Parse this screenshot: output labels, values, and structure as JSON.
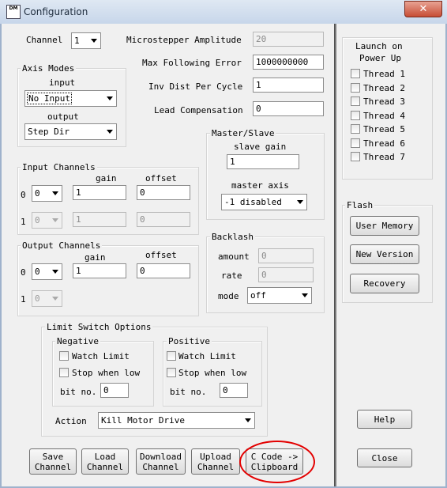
{
  "window": {
    "title": "Configuration",
    "icon_label": "DM",
    "close_glyph": "✕"
  },
  "channel": {
    "label": "Channel",
    "value": "1"
  },
  "fields": {
    "microstepper_label": "Microstepper Amplitude",
    "microstepper_value": "20",
    "max_following_label": "Max Following Error",
    "max_following_value": "1000000000",
    "inv_dist_label": "Inv Dist Per Cycle",
    "inv_dist_value": "1",
    "lead_comp_label": "Lead Compensation",
    "lead_comp_value": "0"
  },
  "axis_modes": {
    "title": "Axis Modes",
    "input_label": "input",
    "input_value": "No Input",
    "output_label": "output",
    "output_value": "Step Dir"
  },
  "input_channels": {
    "title": "Input Channels",
    "gain_header": "gain",
    "offset_header": "offset",
    "rows": [
      {
        "index": "0",
        "channel": "0",
        "gain": "1",
        "offset": "0"
      },
      {
        "index": "1",
        "channel": "0",
        "gain": "1",
        "offset": "0"
      }
    ]
  },
  "output_channels": {
    "title": "Output Channels",
    "gain_header": "gain",
    "offset_header": "offset",
    "rows": [
      {
        "index": "0",
        "channel": "0",
        "gain": "1",
        "offset": "0"
      },
      {
        "index": "1",
        "channel": "0"
      }
    ]
  },
  "master_slave": {
    "title": "Master/Slave",
    "slave_gain_label": "slave gain",
    "slave_gain_value": "1",
    "master_axis_label": "master axis",
    "master_axis_value": "-1 disabled"
  },
  "backlash": {
    "title": "Backlash",
    "amount_label": "amount",
    "amount_value": "0",
    "rate_label": "rate",
    "rate_value": "0",
    "mode_label": "mode",
    "mode_value": "off"
  },
  "limit_switch": {
    "title": "Limit Switch Options",
    "negative": {
      "title": "Negative",
      "watch_limit": "Watch Limit",
      "stop_when_low": "Stop when low",
      "bit_label": "bit no.",
      "bit_value": "0"
    },
    "positive": {
      "title": "Positive",
      "watch_limit": "Watch Limit",
      "stop_when_low": "Stop when low",
      "bit_label": "bit no.",
      "bit_value": "0"
    },
    "action_label": "Action",
    "action_value": "Kill Motor Drive"
  },
  "launch": {
    "title_line1": "Launch on",
    "title_line2": "Power Up",
    "threads": [
      "Thread 1",
      "Thread 2",
      "Thread 3",
      "Thread 4",
      "Thread 5",
      "Thread 6",
      "Thread 7"
    ]
  },
  "flash": {
    "title": "Flash",
    "user_memory": "User Memory",
    "new_version": "New Version",
    "recovery": "Recovery"
  },
  "buttons": {
    "save_l1": "Save",
    "save_l2": "Channel",
    "load_l1": "Load",
    "load_l2": "Channel",
    "download_l1": "Download",
    "download_l2": "Channel",
    "upload_l1": "Upload",
    "upload_l2": "Channel",
    "ccode_l1": "C Code ->",
    "ccode_l2": "Clipboard",
    "help": "Help",
    "close": "Close"
  }
}
